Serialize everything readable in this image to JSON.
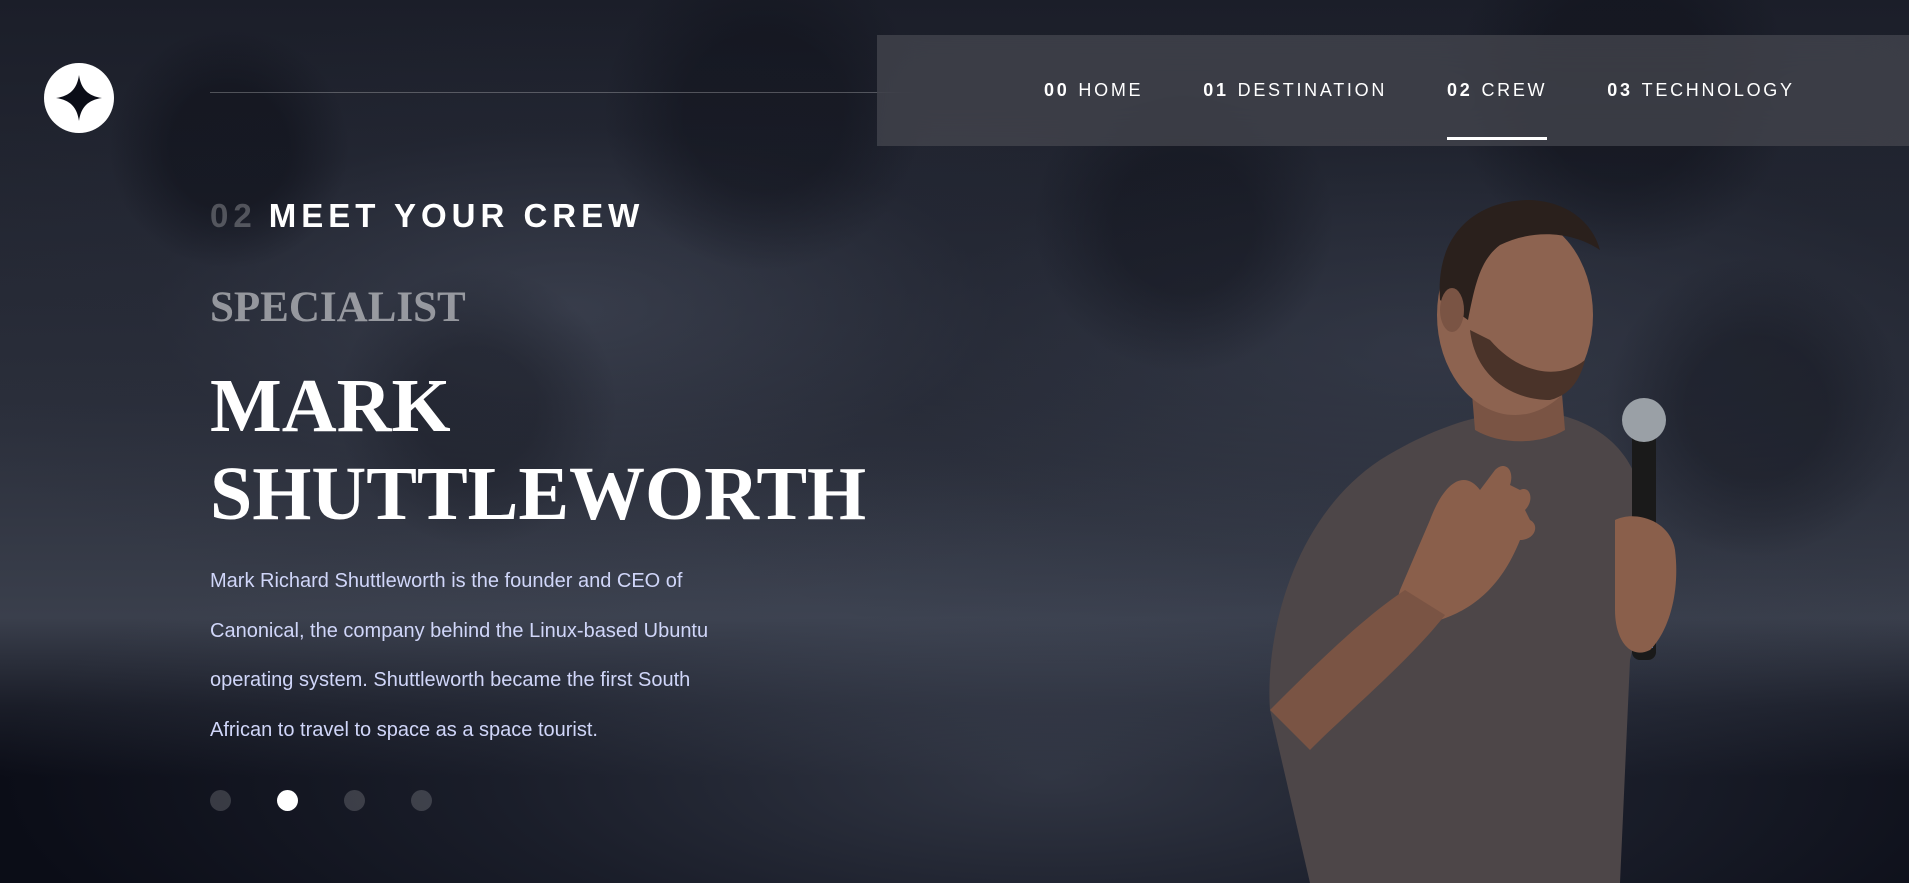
{
  "nav": {
    "items": [
      {
        "num": "00",
        "label": "HOME",
        "active": false
      },
      {
        "num": "01",
        "label": "DESTINATION",
        "active": false
      },
      {
        "num": "02",
        "label": "CREW",
        "active": true
      },
      {
        "num": "03",
        "label": "TECHNOLOGY",
        "active": false
      }
    ]
  },
  "logo": {
    "icon": "star-icon"
  },
  "main": {
    "eyebrow_num": "02",
    "eyebrow_label": "MEET YOUR CREW",
    "role": "SPECIALIST",
    "name": "MARK SHUTTLEWORTH",
    "bio": "Mark Richard Shuttleworth is the founder and CEO of Canonical, the company behind the Linux-based Ubuntu operating system. Shuttleworth became the first South African to travel to space as a space tourist."
  },
  "carousel": {
    "count": 4,
    "active_index": 1
  },
  "colors": {
    "background": "#0b0d17",
    "bio_text": "#d0d6f9",
    "nav_bg": "#46484f"
  }
}
